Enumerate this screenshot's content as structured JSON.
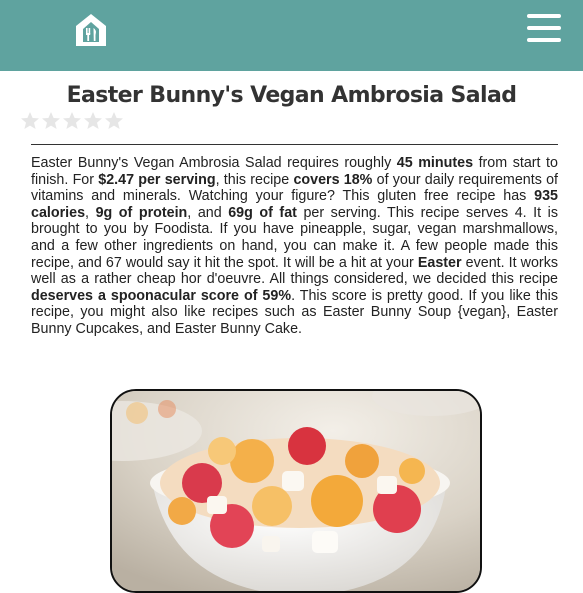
{
  "header": {
    "logo_icon": "house-utensils-icon",
    "menu_icon": "hamburger-menu-icon",
    "bar_color": "#5fa39f"
  },
  "recipe": {
    "title": "Easter Bunny's Vegan Ambrosia Salad",
    "rating": {
      "stars_total": 5,
      "stars_filled": 0,
      "star_color": "#e6e6e6"
    },
    "summary": [
      {
        "t": "Easter Bunny's Vegan Ambrosia Salad requires roughly "
      },
      {
        "t": "45 minutes",
        "b": true
      },
      {
        "t": " from start to finish. For "
      },
      {
        "t": "$2.47 per serving",
        "b": true
      },
      {
        "t": ", this recipe "
      },
      {
        "t": "covers 18%",
        "b": true
      },
      {
        "t": " of your daily requirements of vitamins and minerals. Watching your figure? This gluten free recipe has "
      },
      {
        "t": "935 calories",
        "b": true
      },
      {
        "t": ", "
      },
      {
        "t": "9g of protein",
        "b": true
      },
      {
        "t": ", and "
      },
      {
        "t": "69g of fat",
        "b": true
      },
      {
        "t": " per serving. This recipe serves 4. It is brought to you by Foodista. If you have pineapple, sugar, vegan marshmallows, and a few other ingredients on hand, you can make it. A few people made this recipe, and 67 would say it hit the spot. It will be a hit at your "
      },
      {
        "t": "Easter",
        "b": true
      },
      {
        "t": " event. It works well as a rather cheap hor d'oeuvre. All things considered, we decided this recipe "
      },
      {
        "t": "deserves a spoonacular score of 59%",
        "b": true
      },
      {
        "t": ". This score is pretty good. If you like this recipe, you might also like recipes such as Easter Bunny Soup {vegan}, Easter Bunny Cupcakes, and Easter Bunny Cake."
      }
    ],
    "image_subject": "ambrosia-salad-bowl-photo"
  }
}
